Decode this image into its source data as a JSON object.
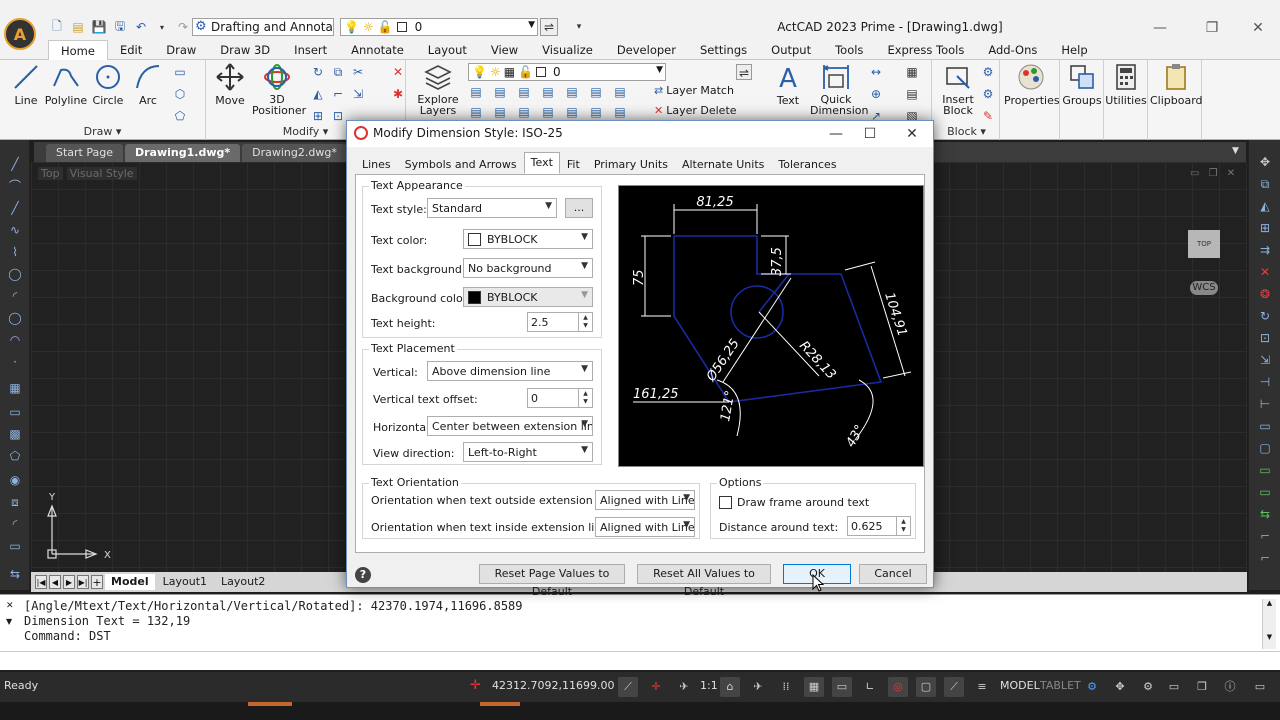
{
  "window": {
    "title": "ActCAD 2023 Prime - [Drawing1.dwg]",
    "workspace": "Drafting and Annotation",
    "qat_layer_value": "0"
  },
  "menu": [
    "Home",
    "Edit",
    "Draw",
    "Draw 3D",
    "Insert",
    "Annotate",
    "Layout",
    "View",
    "Visualize",
    "Developer",
    "Settings",
    "Output",
    "Tools",
    "Express Tools",
    "Add-Ons",
    "Help"
  ],
  "ribbon": {
    "draw": {
      "line": "Line",
      "polyline": "Polyline",
      "circle": "Circle",
      "arc": "Arc",
      "title": "Draw ▾"
    },
    "modify": {
      "move": "Move",
      "positioner_1": "3D",
      "positioner_2": "Positioner",
      "title": "Modify ▾"
    },
    "layers": {
      "explore_1": "Explore",
      "explore_2": "Layers",
      "layer_value": "0",
      "layer_match": "Layer Match",
      "layer_delete": "Layer Delete"
    },
    "annotation": {
      "text": "Text",
      "quick_dim_1": "Quick",
      "quick_dim_2": "Dimension"
    },
    "block": {
      "insert_1": "Insert",
      "insert_2": "Block",
      "title": "Block ▾"
    },
    "properties": "Properties",
    "groups": "Groups",
    "utilities": "Utilities",
    "clipboard": "Clipboard"
  },
  "doc_tabs": [
    "Start Page",
    "Drawing1.dwg*",
    "Drawing2.dwg*"
  ],
  "viewport": {
    "view": "Top",
    "style": "Visual Style",
    "cube": "TOP",
    "wcs": "WCS",
    "ucs_x": "X",
    "ucs_y": "Y"
  },
  "layout_tabs": [
    "Model",
    "Layout1",
    "Layout2"
  ],
  "command_history": [
    "[Angle/Mtext/Text/Horizontal/Vertical/Rotated]: 42370.1974,11696.8589",
    "Dimension Text = 132,19",
    "Command: DST"
  ],
  "status": {
    "ready": "Ready",
    "coords": "42312.7092,11699.0005,0",
    "scale": "1:1",
    "model": "MODEL",
    "tablet": "TABLET"
  },
  "dialog": {
    "title": "Modify Dimension Style: ISO-25",
    "tabs": [
      "Lines",
      "Symbols and Arrows",
      "Text",
      "Fit",
      "Primary Units",
      "Alternate Units",
      "Tolerances"
    ],
    "active_tab": "Text",
    "text_appearance": {
      "title": "Text Appearance",
      "style_label": "Text style:",
      "style_value": "Standard",
      "browse": "...",
      "color_label": "Text color:",
      "color_value": "BYBLOCK",
      "background_label": "Text background:",
      "background_value": "No background",
      "bg_color_label": "Background color:",
      "bg_color_value": "BYBLOCK",
      "height_label": "Text height:",
      "height_value": "2.5"
    },
    "text_placement": {
      "title": "Text Placement",
      "vertical_label": "Vertical:",
      "vertical_value": "Above dimension line",
      "offset_label": "Vertical text offset:",
      "offset_value": "0",
      "horizontal_label": "Horizontal:",
      "horizontal_value": "Center between extension lines",
      "direction_label": "View direction:",
      "direction_value": "Left-to-Right"
    },
    "text_orientation": {
      "title": "Text Orientation",
      "outside_label": "Orientation when text outside extension lines:",
      "outside_value": "Aligned with Line",
      "inside_label": "Orientation when text inside extension lines:",
      "inside_value": "Aligned with Line"
    },
    "options": {
      "title": "Options",
      "frame_label": "Draw frame around text",
      "distance_label": "Distance around text:",
      "distance_value": "0.625"
    },
    "preview_dims": [
      "81,25",
      "37,5",
      "75",
      "104,91",
      "R28,13",
      "Ø56,25",
      "161,25",
      "121°",
      "43°"
    ],
    "buttons": {
      "reset_page": "Reset Page Values to Default",
      "reset_all": "Reset All Values to Default",
      "ok": "OK",
      "cancel": "Cancel"
    }
  }
}
